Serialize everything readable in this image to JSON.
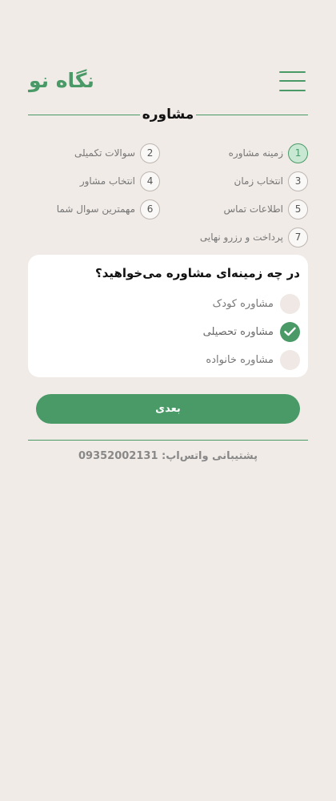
{
  "header": {
    "logo_text": "نگاه نو",
    "menu_icon": "hamburger-menu-icon"
  },
  "page_title": "مشاوره",
  "steps": [
    {
      "num": "1",
      "label": "زمینه مشاوره",
      "active": true
    },
    {
      "num": "2",
      "label": "سوالات تکمیلی",
      "active": false
    },
    {
      "num": "3",
      "label": "انتخاب زمان",
      "active": false
    },
    {
      "num": "4",
      "label": "انتخاب مشاور",
      "active": false
    },
    {
      "num": "5",
      "label": "اطلاعات تماس",
      "active": false
    },
    {
      "num": "6",
      "label": "مهمترین سوال شما",
      "active": false
    },
    {
      "num": "7",
      "label": "پرداخت و رزرو نهایی",
      "active": false
    }
  ],
  "question": {
    "text": "در چه زمینه‌ای مشاوره می‌خواهید؟",
    "options": [
      {
        "label": "مشاوره کودک",
        "selected": false
      },
      {
        "label": "مشاوره تحصیلی",
        "selected": true
      },
      {
        "label": "مشاوره خانواده",
        "selected": false
      }
    ]
  },
  "next_button": "بعدی",
  "support_text": "پشتیبانی واتس‌اپ: 09352002131",
  "colors": {
    "accent": "#4a9a68",
    "background": "#f1ebe7",
    "card": "#ffffff"
  }
}
